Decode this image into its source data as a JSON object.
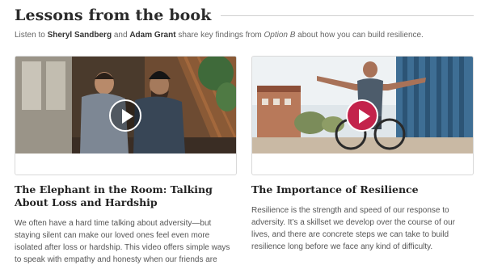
{
  "section": {
    "title": "Lessons from the book",
    "intro": {
      "prefix": "Listen to ",
      "name1": "Sheryl Sandberg",
      "and": " and ",
      "name2": "Adam Grant",
      "middle": " share key findings from ",
      "book": "Option B",
      "suffix": " about how you can build resilience."
    }
  },
  "cards": [
    {
      "title": "The Elephant in the Room: Talking About Loss and Hardship",
      "body": "We often have a hard time talking about adversity—but staying silent can make our loved ones feel even more isolated after loss or hardship. This video offers simple ways to speak with empathy and honesty when our friends are suffering.",
      "play_style": "dark"
    },
    {
      "title": "The Importance of Resilience",
      "body": "Resilience is the strength and speed of our response to adversity. It’s a skillset we develop over the course of our lives, and there are concrete steps we can take to build resilience long before we face any kind of difficulty.",
      "play_style": "red"
    }
  ],
  "colors": {
    "accent_red": "#c3234b",
    "title_rule": "#cfcfcf"
  },
  "icons": {
    "play": "play-icon"
  }
}
